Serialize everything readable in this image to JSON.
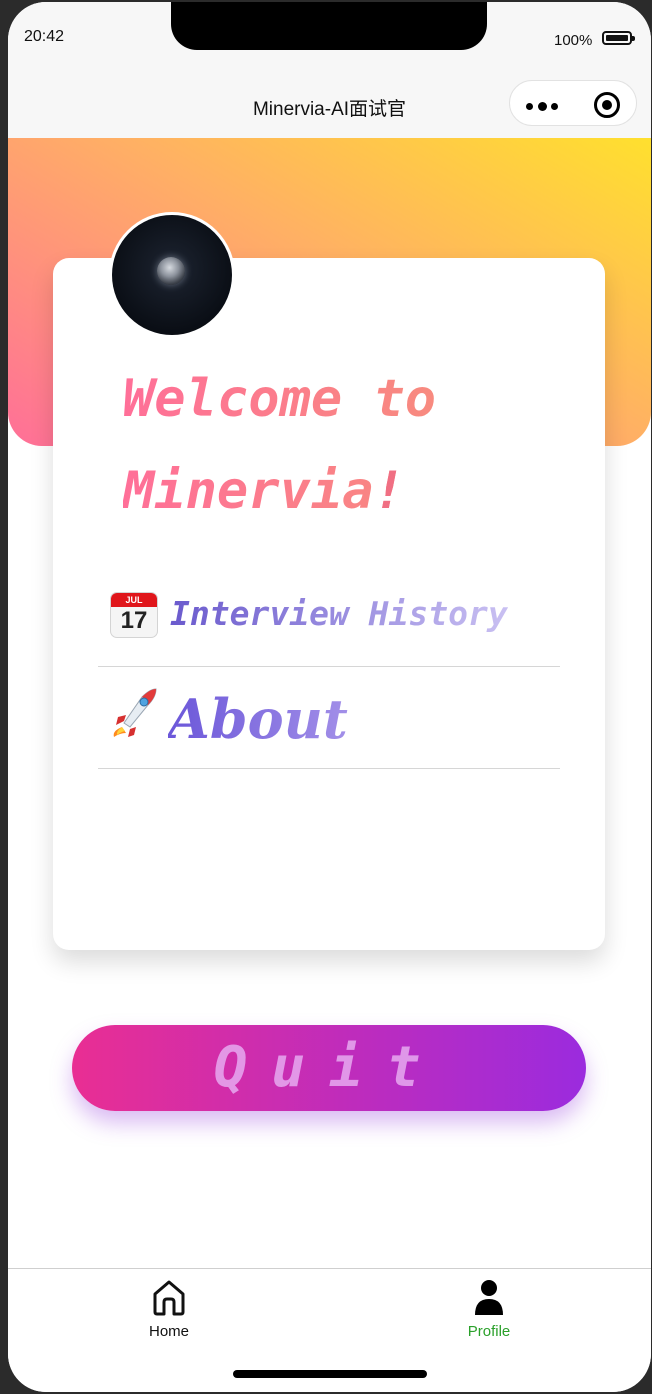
{
  "status_bar": {
    "time": "20:42",
    "battery_percent": "100%"
  },
  "nav": {
    "title": "Minervia-AI面试官",
    "more_icon": "ellipsis-icon",
    "close_icon": "target-icon"
  },
  "profile": {
    "avatar_icon": "moon-avatar"
  },
  "welcome": {
    "line1": "Welcome to",
    "line2": "Minervia",
    "exclamation": "!"
  },
  "menu": {
    "history": {
      "icon": "calendar-icon",
      "icon_month": "JUL",
      "icon_day": "17",
      "label": "Interview History"
    },
    "about": {
      "icon": "rocket-icon",
      "label": "About"
    }
  },
  "quit_button": {
    "label": "Quit"
  },
  "tabbar": {
    "tabs": [
      {
        "label": "Home",
        "icon": "home-icon",
        "active": false
      },
      {
        "label": "Profile",
        "icon": "person-icon",
        "active": true
      }
    ]
  },
  "colors": {
    "banner_gradient": [
      "#ffe02e",
      "#ffb064",
      "#ff6f98"
    ],
    "quit_gradient": [
      "#e92e93",
      "#9b2bde"
    ],
    "active_tab": "#2aa02a"
  }
}
